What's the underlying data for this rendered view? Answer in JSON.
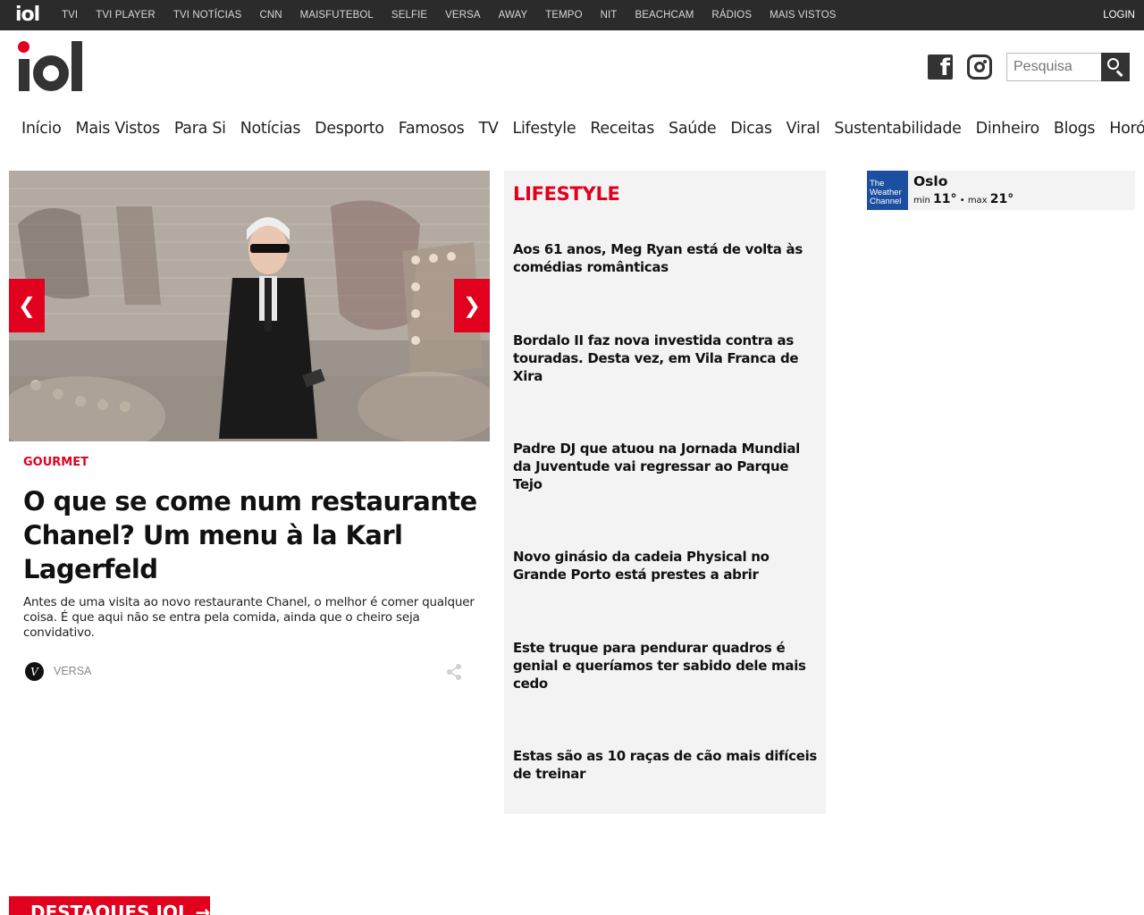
{
  "topbar": {
    "links": [
      "TVI",
      "TVI PLAYER",
      "TVI NOTÍCIAS",
      "CNN",
      "MAISFUTEBOL",
      "SELFIE",
      "VERSA",
      "AWAY",
      "TEMPO",
      "NIT",
      "BEACHCAM",
      "RÁDIOS",
      "MAIS VISTOS"
    ],
    "login": "LOGIN"
  },
  "header": {
    "search_placeholder": "Pesquisa"
  },
  "nav": [
    "Início",
    "Mais Vistos",
    "Para Si",
    "Notícias",
    "Desporto",
    "Famosos",
    "TV",
    "Lifestyle",
    "Receitas",
    "Saúde",
    "Dicas",
    "Viral",
    "Sustentabilidade",
    "Dinheiro",
    "Blogs",
    "Horóscopo"
  ],
  "hero": {
    "prev": "❮",
    "next": "❯",
    "kicker": "GOURMET",
    "headline": "O que se come num restaurante Chanel? Um menu à la Karl Lagerfeld",
    "lead": "Antes de uma visita ao novo restaurante Chanel, o melhor é comer qualquer coisa. É que aqui não se entra pela comida, ainda que o cheiro seja convidativo.",
    "source": "VERSA",
    "source_icon": "V"
  },
  "lifestyle": {
    "title": "LIFESTYLE",
    "items": [
      "Aos 61 anos, Meg Ryan está de volta às comédias românticas",
      "Bordalo II faz nova investida contra as touradas. Desta vez, em Vila Franca de Xira",
      "Padre DJ que atuou na Jornada Mundial da Juventude vai regressar ao Parque Tejo",
      "Novo ginásio da cadeia Physical no Grande Porto está prestes a abrir",
      "Este truque para pendurar quadros é genial e queríamos ter sabido dele mais cedo",
      "Estas são as 10 raças de cão mais difíceis de treinar"
    ]
  },
  "weather": {
    "logo_line1": "The",
    "logo_line2": "Weather",
    "logo_line3": "Channel",
    "city": "Oslo",
    "min_label": "min",
    "min": "11°",
    "sep": "•",
    "max_label": "max",
    "max": "21°"
  },
  "destaques": "DESTAQUES IOL →",
  "colors": {
    "accent": "#e1001e",
    "topbar": "#2b2b2b",
    "panel": "#f3f3f3",
    "weather_brand": "#1d4fa0"
  }
}
